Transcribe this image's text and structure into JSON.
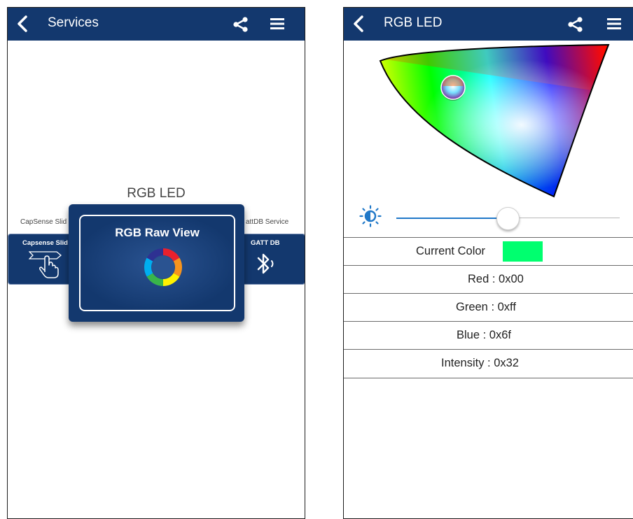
{
  "left_screen": {
    "nav": {
      "title": "Services",
      "back_icon": "chevron-left-icon",
      "share_icon": "share-icon",
      "menu_icon": "hamburger-menu-icon"
    },
    "carousel": {
      "title": "RGB LED",
      "left_card": {
        "caption": "CapSense Slid",
        "label": "Capsense Slid",
        "icon": "swipe-hand-icon"
      },
      "center_card": {
        "label": "RGB Raw View",
        "icon": "color-ring-icon"
      },
      "right_card": {
        "caption": "attDB Service",
        "label": "GATT DB",
        "icon": "bluetooth-icon"
      }
    }
  },
  "right_screen": {
    "nav": {
      "title": "RGB LED",
      "back_icon": "chevron-left-icon",
      "share_icon": "share-icon",
      "menu_icon": "hamburger-menu-icon"
    },
    "color_picker": {
      "icon": "color-gamut-triangle",
      "cursor_icon": "color-cursor-icon"
    },
    "intensity_slider": {
      "icon": "brightness-icon",
      "value": "0x32"
    },
    "current_color": {
      "label": "Current Color",
      "swatch_color": "#00ff6f"
    },
    "values": {
      "red": "Red : 0x00",
      "green": "Green : 0xff",
      "blue": "Blue : 0x6f",
      "intensity": "Intensity : 0x32"
    }
  },
  "colors": {
    "nav_bar": "#13386e",
    "slider_active": "#2078c8"
  }
}
